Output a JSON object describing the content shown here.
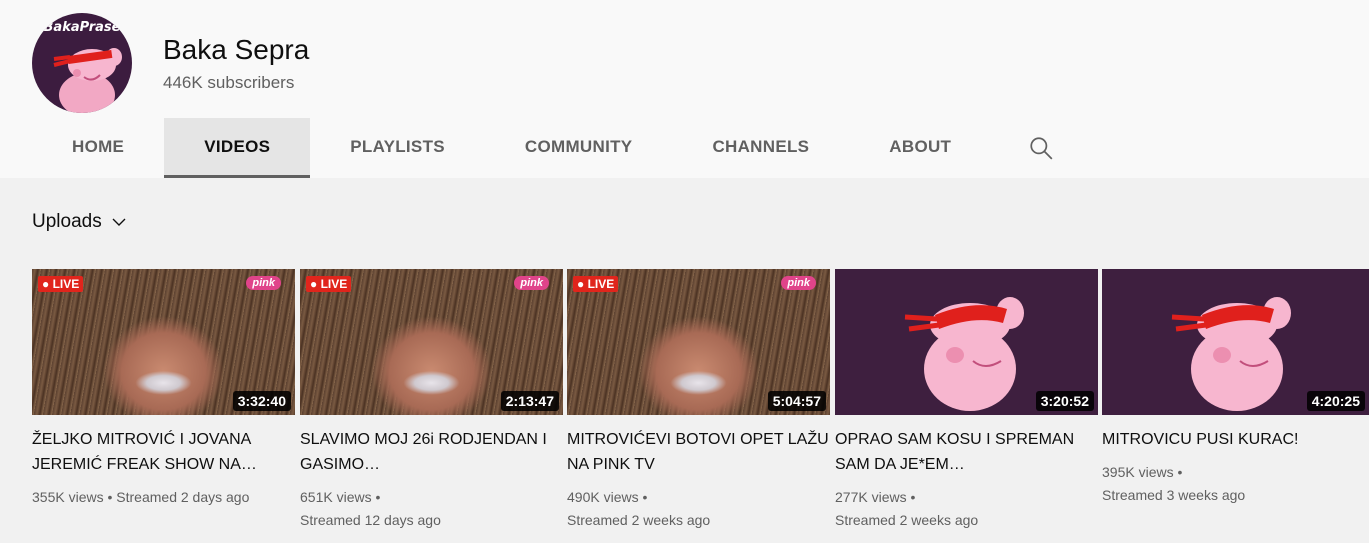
{
  "channel": {
    "avatar_text": "BakaPrase",
    "name": "Baka Sepra",
    "subscribers": "446K subscribers"
  },
  "tabs": [
    {
      "label": "HOME"
    },
    {
      "label": "VIDEOS",
      "active": true
    },
    {
      "label": "PLAYLISTS"
    },
    {
      "label": "COMMUNITY"
    },
    {
      "label": "CHANNELS"
    },
    {
      "label": "ABOUT"
    }
  ],
  "search_icon": "search-icon",
  "uploads": {
    "label": "Uploads",
    "icon": "chevron-down-icon"
  },
  "videos": [
    {
      "title": "ŽELJKO MITROVIĆ I JOVANA JEREMIĆ FREAK SHOW NA…",
      "views": "355K views",
      "age": "Streamed 2 days ago",
      "duration": "3:32:40",
      "thumb": "face",
      "live": "LIVE",
      "logo": "pink"
    },
    {
      "title": "SLAVIMO MOJ 26i RODJENDAN I GASIMO…",
      "views": "651K views",
      "age": "Streamed 12 days ago",
      "duration": "2:13:47",
      "thumb": "face",
      "live": "LIVE",
      "logo": "pink"
    },
    {
      "title": "MITROVIĆEVI BOTOVI OPET LAŽU NA PINK TV",
      "views": "490K views",
      "age": "Streamed 2 weeks ago",
      "duration": "5:04:57",
      "thumb": "face",
      "live": "LIVE",
      "logo": "pink"
    },
    {
      "title": "OPRAO SAM KOSU I SPREMAN SAM DA JE*EM…",
      "views": "277K views",
      "age": "Streamed 2 weeks ago",
      "duration": "3:20:52",
      "thumb": "peppa"
    },
    {
      "title": "MITROVICU PUSI KURAC!",
      "views": "395K views",
      "age": "Streamed 3 weeks ago",
      "duration": "4:20:25",
      "thumb": "peppa"
    }
  ],
  "colors": {
    "live_red": "#e0251c",
    "pink_brand": "#e0448a",
    "peppa_bg": "#3e1f3f"
  }
}
